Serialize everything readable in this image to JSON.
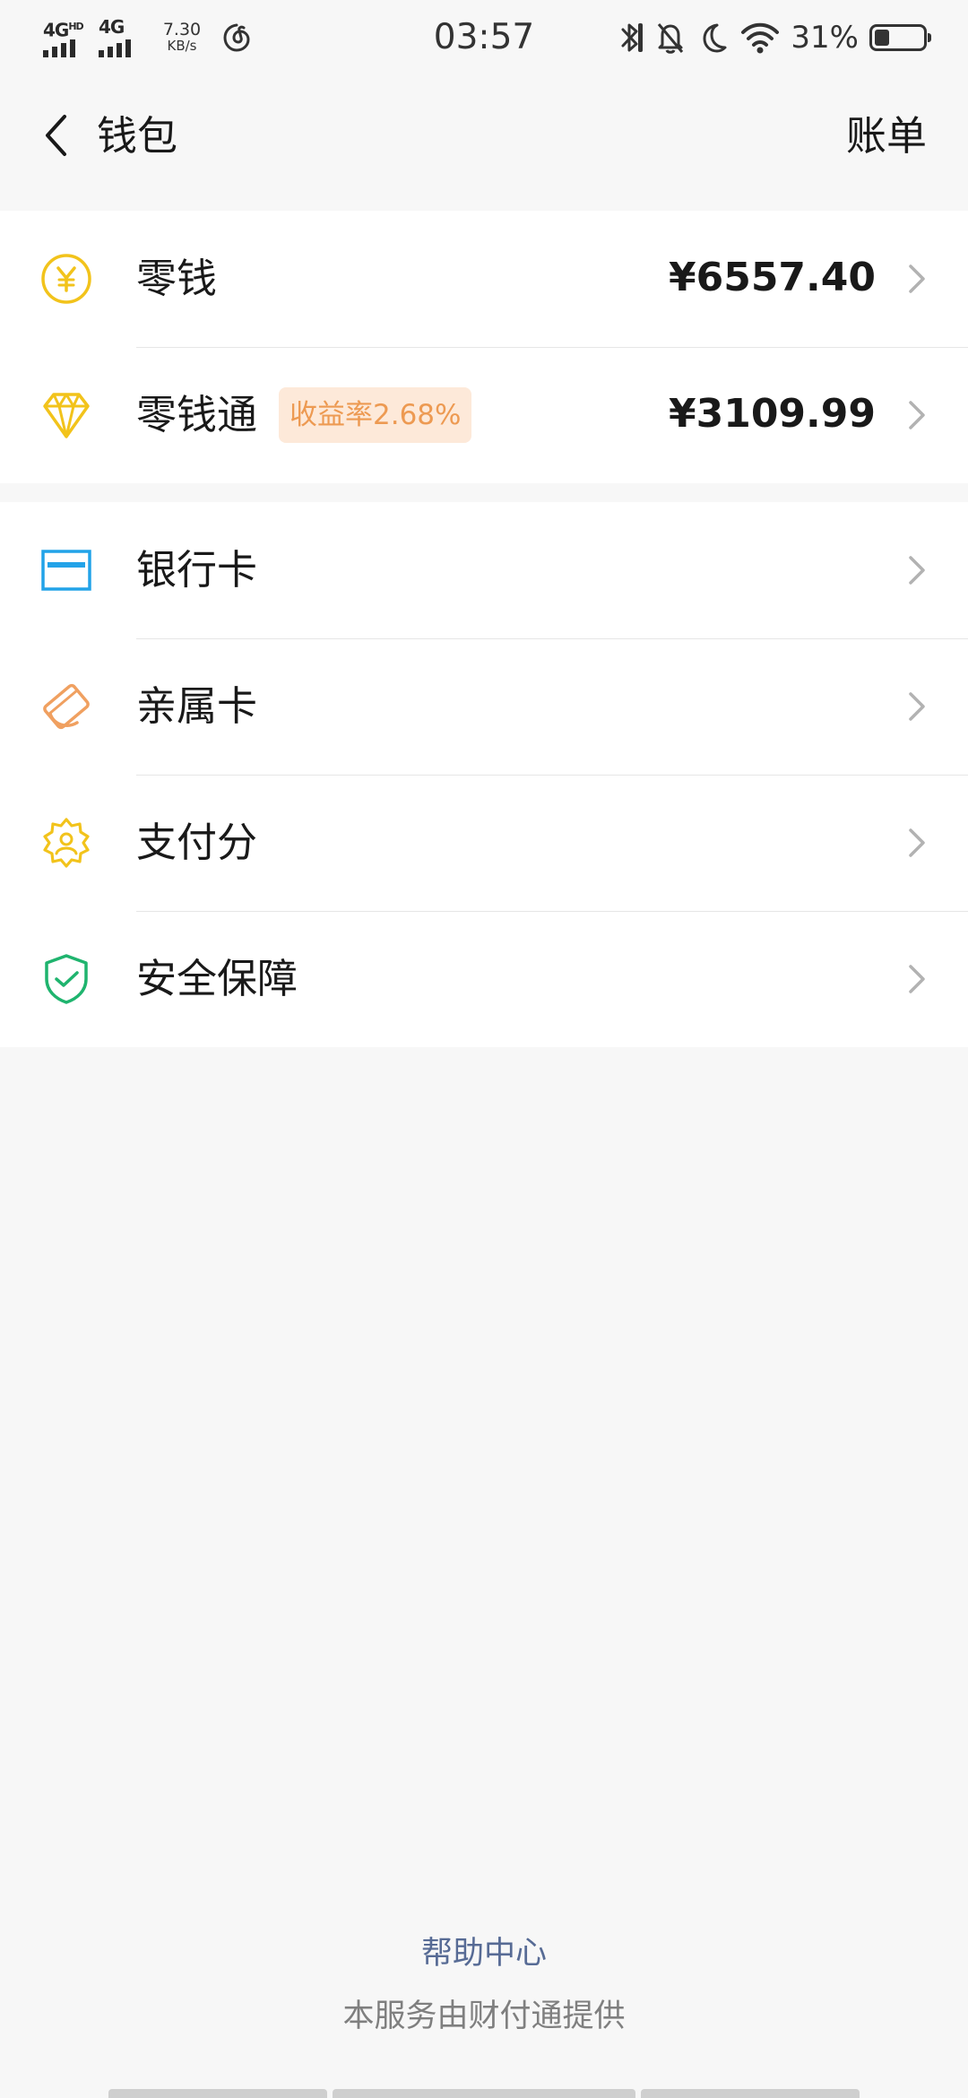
{
  "status_bar": {
    "signal_1_label": "4G",
    "signal_1_suffix": "HD",
    "signal_2_label": "4G",
    "net_speed_value": "7.30",
    "net_speed_unit": "KB/s",
    "time": "03:57",
    "battery_percent": "31%",
    "battery_level": 0.31
  },
  "nav": {
    "title": "钱包",
    "bill_label": "账单"
  },
  "balance_group": [
    {
      "label": "零钱",
      "value": "¥6557.40",
      "icon": "yuan-coin-icon",
      "color": "#f2c31b"
    },
    {
      "label": "零钱通",
      "badge": "收益率2.68%",
      "value": "¥3109.99",
      "icon": "diamond-icon",
      "color": "#f2c31b"
    }
  ],
  "services_group": [
    {
      "label": "银行卡",
      "icon": "bank-card-icon",
      "color": "#22a3e8"
    },
    {
      "label": "亲属卡",
      "icon": "family-card-icon",
      "color": "#f0a060"
    },
    {
      "label": "支付分",
      "icon": "pay-score-icon",
      "color": "#f2c31b"
    },
    {
      "label": "安全保障",
      "icon": "security-shield-icon",
      "color": "#1fb46e"
    }
  ],
  "footer": {
    "help_label": "帮助中心",
    "provider_note": "本服务由财付通提供"
  }
}
